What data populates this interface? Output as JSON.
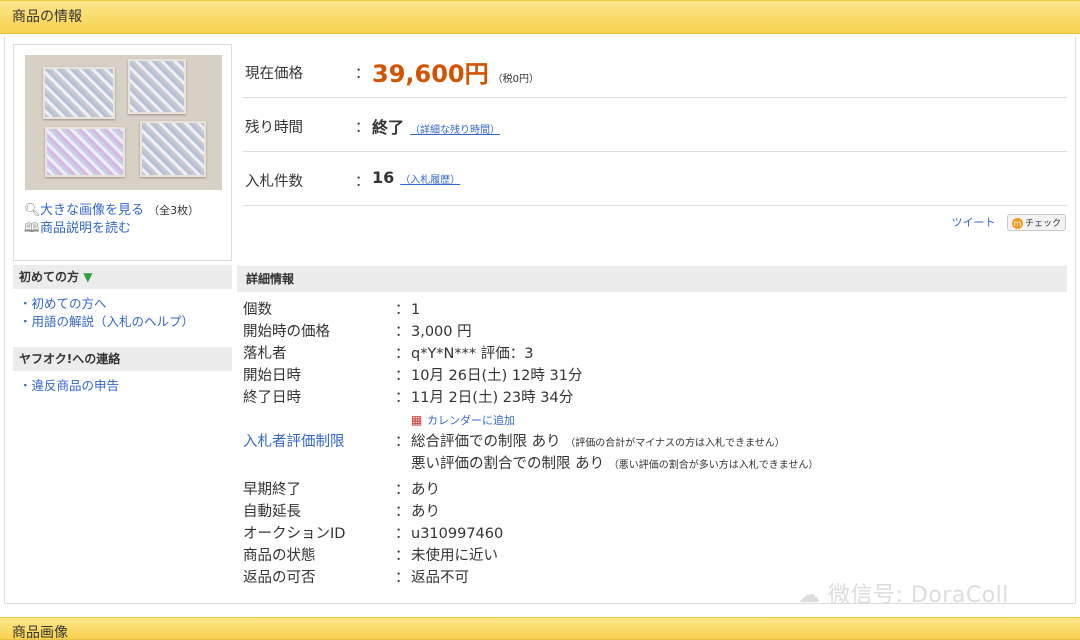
{
  "header": {
    "title": "商品の情報"
  },
  "image_panel": {
    "view_large": "大きな画像を見る",
    "count": "（全3枚）",
    "read_desc": "商品説明を読む"
  },
  "sidebar": {
    "beginner_title": "初めての方",
    "links1": [
      "・初めての方へ",
      "・用語の解説（入札のヘルプ）"
    ],
    "contact_title": "ヤフオク!への連絡",
    "links2": [
      "・違反商品の申告"
    ]
  },
  "summary": {
    "price_label": "現在価格",
    "price": "39,600円",
    "tax": "（税0円）",
    "time_label": "残り時間",
    "time_value": "終了",
    "time_link": "（詳細な残り時間）",
    "bids_label": "入札件数",
    "bids_value": "16",
    "bids_link": "（入札履歴）",
    "colon": "："
  },
  "share": {
    "tweet": "ツイート",
    "check": "チェック",
    "check_icon": "m"
  },
  "details": {
    "title": "詳細情報",
    "colon": "：",
    "quantity_label": "個数",
    "quantity": "1",
    "start_price_label": "開始時の価格",
    "start_price": "3,000 円",
    "winner_label": "落札者",
    "winner": "q*Y*N*** 評価：3",
    "start_date_label": "開始日時",
    "start_date": "10月 26日(土) 12時 31分",
    "end_date_label": "終了日時",
    "end_date": "11月 2日(土) 23時 34分",
    "calendar_link": "カレンダーに追加",
    "restriction_label": "入札者評価制限",
    "restriction1": "総合評価での制限 あり",
    "restriction1_note": "（評価の合計がマイナスの方は入札できません）",
    "restriction2": "悪い評価の割合での制限 あり",
    "restriction2_note": "（悪い評価の割合が多い方は入札できません）",
    "early_end_label": "早期終了",
    "early_end": "あり",
    "auto_ext_label": "自動延長",
    "auto_ext": "あり",
    "auction_id_label": "オークションID",
    "auction_id": "u310997460",
    "condition_label": "商品の状態",
    "condition": "未使用に近い",
    "returns_label": "返品の可否",
    "returns": "返品不可"
  },
  "footer_header": {
    "title": "商品画像"
  },
  "watermark": "微信号: DoraColl"
}
